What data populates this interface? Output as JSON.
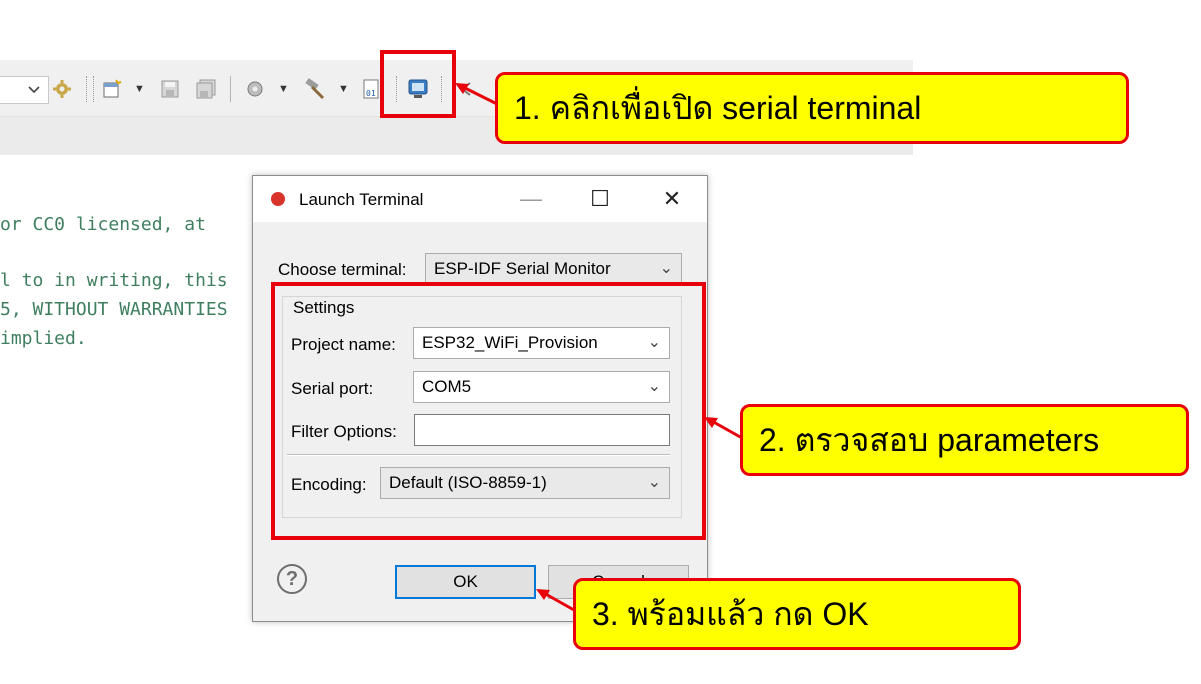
{
  "editor": {
    "lines": [
      "or CC0 licensed, at",
      "l to in writing, this",
      "5, WITHOUT WARRANTIES",
      "implied."
    ]
  },
  "toolbar": {
    "icons": [
      "chevron-down-icon",
      "gear-icon",
      "new-file-icon",
      "caret-down-icon",
      "save-icon",
      "save-all-icon",
      "build-settings-icon",
      "caret-down-icon",
      "hammer-icon",
      "caret-down-icon",
      "binary-icon",
      "terminal-icon",
      "back-icon"
    ]
  },
  "callouts": {
    "step1": "1. คลิกเพื่อเปิด  serial terminal",
    "step2": "2. ตรวจสอบ parameters",
    "step3": "3. พร้อมแล้ว กด OK"
  },
  "dialog": {
    "title": "Launch Terminal",
    "minimize": "—",
    "maximize": "☐",
    "close": "✕",
    "choose_terminal_label": "Choose terminal:",
    "choose_terminal_value": "ESP-IDF Serial Monitor",
    "settings_group": "Settings",
    "project_name_label": "Project name:",
    "project_name_value": "ESP32_WiFi_Provision",
    "serial_port_label": "Serial port:",
    "serial_port_value": "COM5",
    "filter_options_label": "Filter Options:",
    "filter_options_value": "",
    "encoding_label": "Encoding:",
    "encoding_value": "Default (ISO-8859-1)",
    "help": "?",
    "ok_label": "OK",
    "cancel_label": "Cancel"
  },
  "colors": {
    "highlight_red": "#e8000b",
    "callout_yellow": "#ffff00",
    "comment_green": "#3f7f5f"
  }
}
